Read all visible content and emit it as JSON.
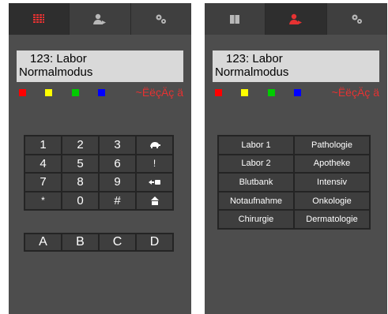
{
  "colors": {
    "panel_bg": "#4d4d4d",
    "display_bg": "#d9d9d9",
    "accent_red": "#e63232",
    "key_bg": "#3e3e3e"
  },
  "left": {
    "tabs": [
      {
        "icon": "keypad-icon",
        "active": true
      },
      {
        "icon": "user-transfer-icon",
        "active": false
      },
      {
        "icon": "gears-icon",
        "active": false
      }
    ],
    "display": {
      "line1": "123: Labor",
      "line2": "Normalmodus"
    },
    "leds": [
      "#ff0000",
      "#ffff00",
      "#00cc00",
      "#0000ff"
    ],
    "status_text": "~ËëçÄç ä",
    "keys": [
      "1",
      "2",
      "3",
      "",
      "4",
      "5",
      "6",
      "!",
      "7",
      "8",
      "9",
      "",
      "*",
      "0",
      "#",
      ""
    ],
    "function_keys": [
      "A",
      "B",
      "C",
      "D"
    ]
  },
  "right": {
    "tabs": [
      {
        "icon": "book-icon",
        "active": false
      },
      {
        "icon": "user-transfer-icon",
        "active": true
      },
      {
        "icon": "gears-icon",
        "active": false
      }
    ],
    "display": {
      "line1": "123: Labor",
      "line2": "Normalmodus"
    },
    "leds": [
      "#ff0000",
      "#ffff00",
      "#00cc00",
      "#0000ff"
    ],
    "status_text": "~ËëçÄç ä",
    "departments": [
      "Labor 1",
      "Pathologie",
      "Labor 2",
      "Apotheke",
      "Blutbank",
      "Intensiv",
      "Notaufnahme",
      "Onkologie",
      "Chirurgie",
      "Dermatologie"
    ]
  }
}
